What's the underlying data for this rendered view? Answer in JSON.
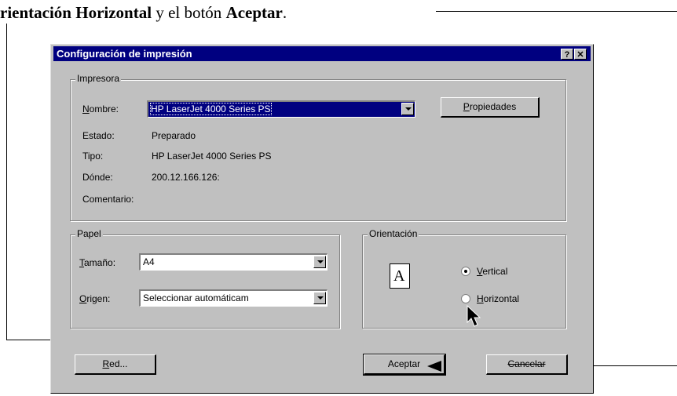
{
  "caption": {
    "part1": "rientación Horizontal",
    "part2": " y el botón ",
    "part3": "Aceptar",
    "part4": "."
  },
  "dialog": {
    "title": "Configuración de impresión",
    "help_button": "?",
    "close_button": "✕",
    "printer_group": {
      "label": "Impresora",
      "name_label": "Nombre:",
      "name_value": "HP LaserJet 4000 Series PS",
      "properties_button": "Propiedades",
      "status_label": "Estado:",
      "status_value": "Preparado",
      "type_label": "Tipo:",
      "type_value": "HP LaserJet 4000 Series PS",
      "where_label": "Dónde:",
      "where_value": "200.12.166.126:",
      "comment_label": "Comentario:"
    },
    "paper_group": {
      "label": "Papel",
      "size_label": "Tamaño:",
      "size_value": "A4",
      "source_label": "Origen:",
      "source_value": "Seleccionar automáticam"
    },
    "orientation_group": {
      "label": "Orientación",
      "page_glyph": "A",
      "vertical_label": "Vertical",
      "horizontal_label": "Horizontal",
      "selected": "Vertical"
    },
    "network_button": "Red...",
    "ok_button": "Aceptar",
    "cancel_button": "Cancelar"
  }
}
